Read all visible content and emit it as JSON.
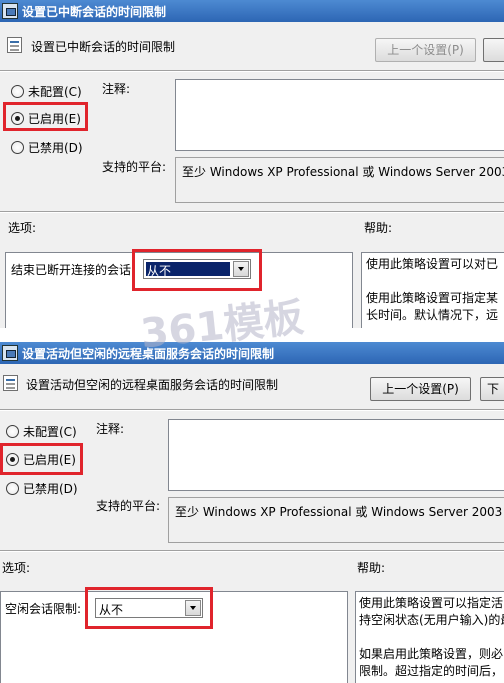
{
  "panel1": {
    "title": "设置已中断会话的时间限制",
    "setting_name": "设置已中断会话的时间限制",
    "prev_button": "上一个设置(P)",
    "options": [
      {
        "label": "未配置(C)",
        "checked": false
      },
      {
        "label": "已启用(E)",
        "checked": true
      },
      {
        "label": "已禁用(D)",
        "checked": false
      }
    ],
    "comment_label": "注释:",
    "platform_label": "支持的平台:",
    "platform_value": "至少 Windows XP Professional 或 Windows Server 2003",
    "options_header": "选项:",
    "help_header": "帮助:",
    "option_label": "结束已断开连接的会话",
    "option_value": "从不",
    "help_lines": [
      "使用此策略设置可以对已",
      "",
      "使用此策略设置可指定某",
      "长时间。默认情况下，远"
    ]
  },
  "panel2": {
    "title": "设置活动但空闲的远程桌面服务会话的时间限制",
    "setting_name": "设置活动但空闲的远程桌面服务会话的时间限制",
    "prev_button": "上一个设置(P)",
    "next_button": "下",
    "options": [
      {
        "label": "未配置(C)",
        "checked": false
      },
      {
        "label": "已启用(E)",
        "checked": true
      },
      {
        "label": "已禁用(D)",
        "checked": false
      }
    ],
    "comment_label": "注释:",
    "platform_label": "支持的平台:",
    "platform_value": "至少 Windows XP Professional 或 Windows Server 2003 系",
    "options_header": "选项:",
    "help_header": "帮助:",
    "option_label": "空闲会话限制:",
    "option_value": "从不",
    "help_lines": [
      "使用此策略设置可以指定活",
      "持空闲状态(无用户输入)的最",
      "",
      "如果启用此策略设置，则必",
      "限制。超过指定的时间后，"
    ]
  },
  "watermark": "361模板",
  "colors": {
    "highlight_red": "#e0242c",
    "title_blue": "#2d66b4",
    "select_blue": "#0a246a"
  }
}
